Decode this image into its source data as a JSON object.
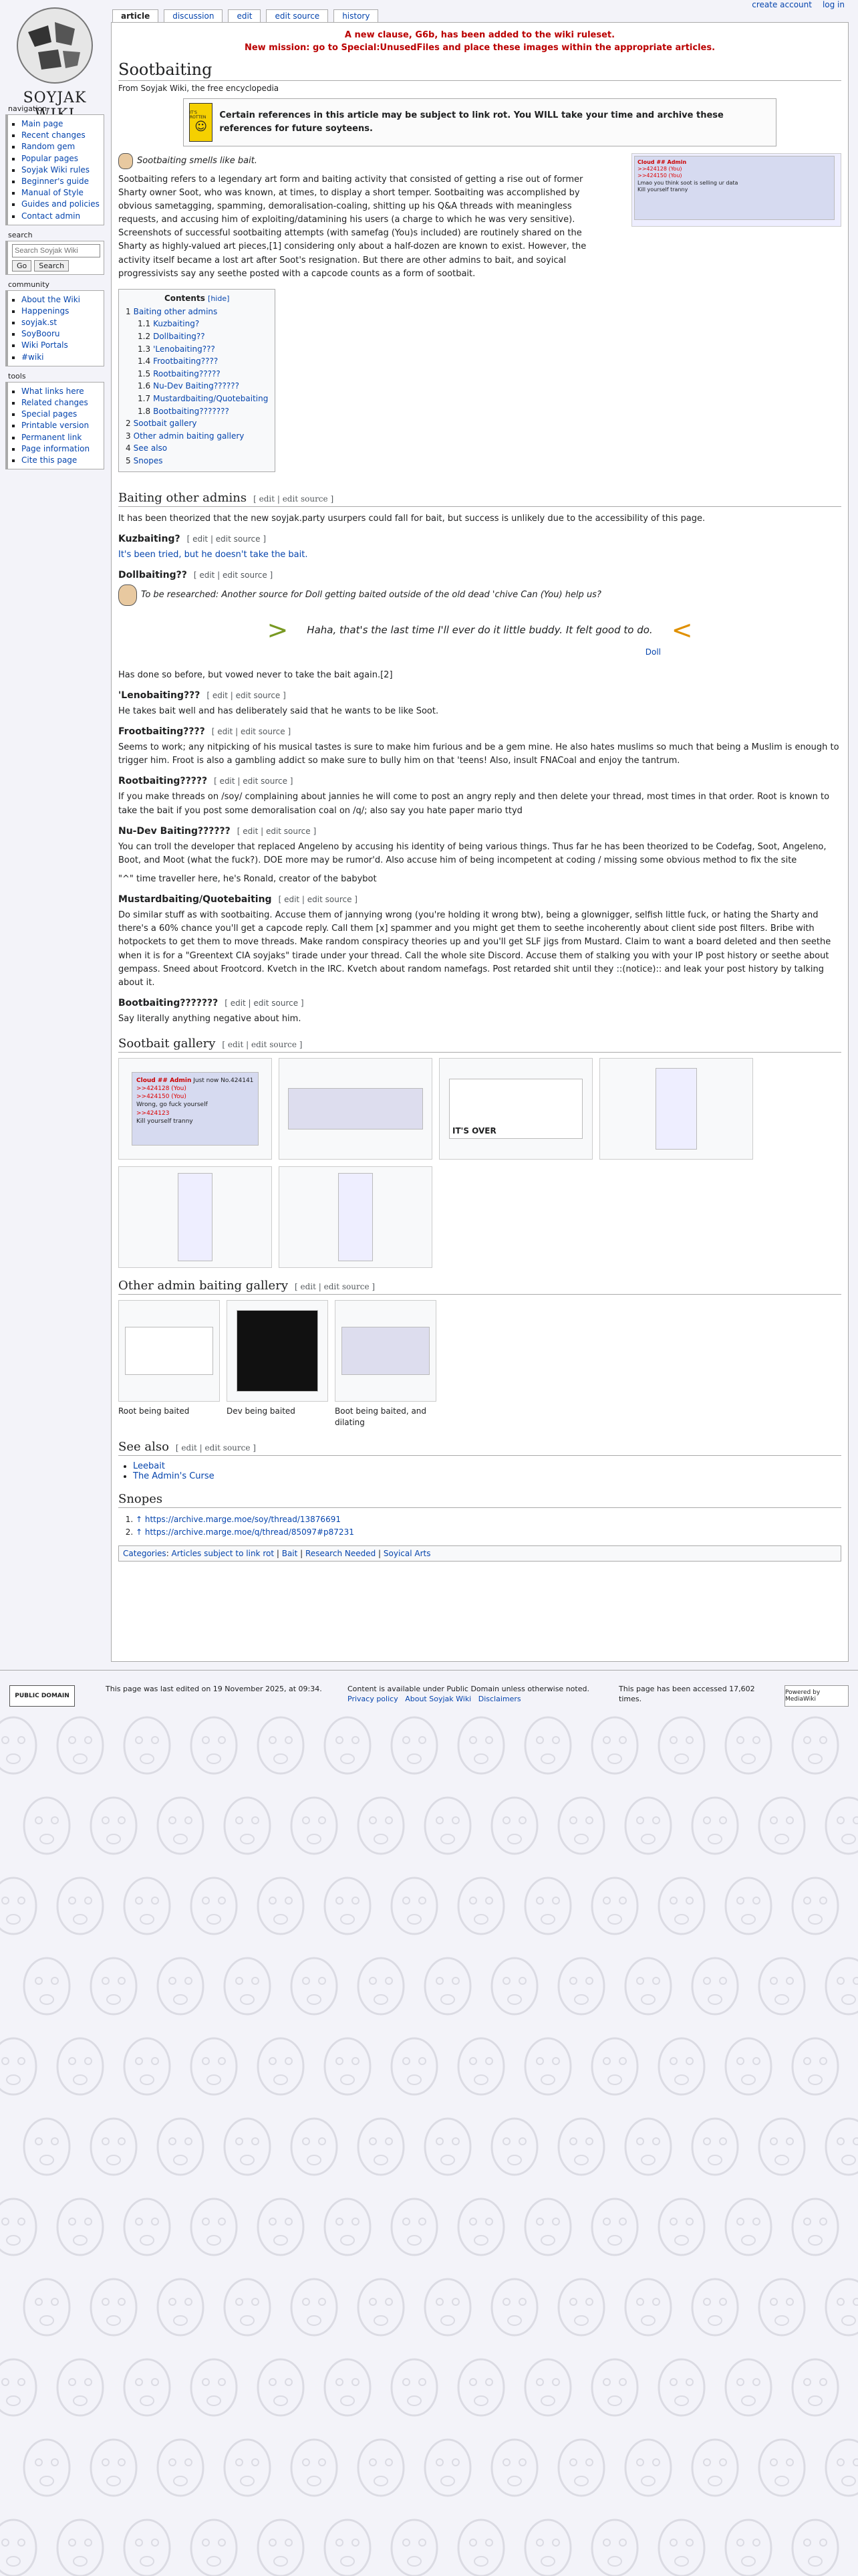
{
  "personal": {
    "create_account": "create account",
    "log_in": "log in"
  },
  "logo": {
    "text": "SOYJAK WIKI"
  },
  "nav": {
    "navigation_title": "navigation",
    "navigation": [
      "Main page",
      "Recent changes",
      "Random gem",
      "Popular pages",
      "Soyjak Wiki rules",
      "Beginner's guide",
      "Manual of Style",
      "Guides and policies",
      "Contact admin"
    ],
    "search_title": "search",
    "search_placeholder": "Search Soyjak Wiki",
    "go": "Go",
    "search_button": "Search",
    "community_title": "community",
    "community": [
      "About the Wiki",
      "Happenings",
      "soyjak.st",
      "SoyBooru",
      "Wiki Portals",
      "#wiki"
    ],
    "tools_title": "tools",
    "tools": [
      "What links here",
      "Related changes",
      "Special pages",
      "Printable version",
      "Permanent link",
      "Page information",
      "Cite this page"
    ]
  },
  "tabs": [
    "article",
    "discussion",
    "edit",
    "edit source",
    "history"
  ],
  "sitenotice": {
    "line1": "A new clause, G6b, has been added to the wiki ruleset.",
    "line2": "New mission: go to Special:UnusedFiles and place these images within the appropriate articles."
  },
  "page": {
    "title": "Sootbaiting",
    "tagline": "From Soyjak Wiki, the free encyclopedia",
    "linkrot_sign": "IT'S ROTTEN",
    "linkrot_text": "Certain references in this article may be subject to link rot. You WILL take your time and archive these references for future soyteens.",
    "smell": "Sootbaiting smells like bait.",
    "lead": "Sootbaiting refers to a legendary art form and baiting activity that consisted of getting a rise out of former Sharty owner Soot, who was known, at times, to display a short temper. Sootbaiting was accomplished by obvious sametagging, spamming, demoralisation-coaling, shitting up his Q&A threads with meaningless requests, and accusing him of exploiting/datamining his users (a charge to which he was very sensitive). Screenshots of successful sootbaiting attempts (with samefag (You)s included) are routinely shared on the Sharty as highly-valued art pieces,[1] considering only about a half-dozen are known to exist. However, the activity itself became a lost art after Soot's resignation. But there are other admins to bait, and soyical progressivists say any seethe posted with a capcode counts as a form of sootbait."
  },
  "hero_post": {
    "header": "Cloud ## Admin",
    "lines": [
      ">>424128 (You)",
      ">>424150 (You)",
      "Lmao you think soot is selling ur data",
      "Kill yourself tranny"
    ]
  },
  "toc": {
    "title": "Contents",
    "hide": "[hide]",
    "items": [
      {
        "n": "1",
        "t": "Baiting other admins",
        "sub": false
      },
      {
        "n": "1.1",
        "t": "Kuzbaiting?",
        "sub": true
      },
      {
        "n": "1.2",
        "t": "Dollbaiting??",
        "sub": true
      },
      {
        "n": "1.3",
        "t": "'Lenobaiting???",
        "sub": true
      },
      {
        "n": "1.4",
        "t": "Frootbaiting????",
        "sub": true
      },
      {
        "n": "1.5",
        "t": "Rootbaiting?????",
        "sub": true
      },
      {
        "n": "1.6",
        "t": "Nu-Dev Baiting??????",
        "sub": true
      },
      {
        "n": "1.7",
        "t": "Mustardbaiting/Quotebaiting",
        "sub": true
      },
      {
        "n": "1.8",
        "t": "Bootbaiting???????",
        "sub": true
      },
      {
        "n": "2",
        "t": "Sootbait gallery",
        "sub": false
      },
      {
        "n": "3",
        "t": "Other admin baiting gallery",
        "sub": false
      },
      {
        "n": "4",
        "t": "See also",
        "sub": false
      },
      {
        "n": "5",
        "t": "Snopes",
        "sub": false
      }
    ]
  },
  "edit_label": "[ edit | edit source ]",
  "sections": {
    "baiting_other_admins": {
      "title": "Baiting other admins",
      "text": "It has been theorized that the new soyjak.party usurpers could fall for bait, but success is unlikely due to the accessibility of this page."
    },
    "kuzbaiting": {
      "title": "Kuzbaiting?",
      "text": "It's been tried, but he doesn't take the bait."
    },
    "dollbaiting": {
      "title": "Dollbaiting??",
      "note": "To be researched: Another source for Doll getting baited outside of the old dead 'chive Can (You) help us?",
      "quote": "Haha, that's the last time I'll ever do it little buddy. It felt good to do.",
      "quote_attr": "Doll",
      "after": "Has done so before, but vowed never to take the bait again.[2]"
    },
    "lenobaiting": {
      "title": "'Lenobaiting???",
      "text": "He takes bait well and has deliberately said that he wants to be like Soot."
    },
    "frootbaiting": {
      "title": "Frootbaiting????",
      "text": "Seems to work; any nitpicking of his musical tastes is sure to make him furious and be a gem mine. He also hates muslims so much that being a Muslim is enough to trigger him. Froot is also a gambling addict so make sure to bully him on that 'teens! Also, insult FNACoal and enjoy the tantrum."
    },
    "rootbaiting": {
      "title": "Rootbaiting?????",
      "text": "If you make threads on /soy/ complaining about jannies he will come to post an angry reply and then delete your thread, most times in that order. Root is known to take the bait if you post some demoralisation coal on /q/; also say you hate paper mario ttyd"
    },
    "nudev": {
      "title": "Nu-Dev Baiting??????",
      "text": "You can troll the developer that replaced Angeleno by accusing his identity of being various things. Thus far he has been theorized to be Codefag, Soot, Angeleno, Boot, and Moot (what the fuck?). DOE more may be rumor'd. Also accuse him of being incompetent at coding / missing some obvious method to fix the site",
      "text2": "\"^\" time traveller here, he's Ronald, creator of the babybot"
    },
    "mustard": {
      "title": "Mustardbaiting/Quotebaiting",
      "text": "Do similar stuff as with sootbaiting. Accuse them of jannying wrong (you're holding it wrong btw), being a glownigger, selfish little fuck, or hating the Sharty and there's a 60% chance you'll get a capcode reply. Call them [x] spammer and you might get them to seethe incoherently about client side post filters. Bribe with hotpockets to get them to move threads. Make random conspiracy theories up and you'll get SLF jigs from Mustard. Claim to want a board deleted and then seethe when it is for a \"Greentext CIA soyjaks\" tirade under your thread. Call the whole site Discord. Accuse them of stalking you with your IP post history or seethe about gempass. Sneed about Frootcord. Kvetch in the IRC. Kvetch about random namefags. Post retarded shit until they ::(notice):: and leak your post history by talking about it."
    },
    "bootbaiting": {
      "title": "Bootbaiting???????",
      "text": "Say literally anything negative about him."
    },
    "sootbait_gallery": {
      "title": "Sootbait gallery"
    },
    "other_gallery": {
      "title": "Other admin baiting gallery",
      "captions": [
        "Root being baited",
        "Dev being baited",
        "Boot being baited, and dilating"
      ]
    },
    "see_also": {
      "title": "See also",
      "items": [
        "Leebait",
        "The Admin's Curse"
      ]
    },
    "snopes": {
      "title": "Snopes",
      "refs": [
        "↑ https://archive.marge.moe/soy/thread/13876691",
        "↑ https://archive.marge.moe/q/thread/85097#p87231"
      ]
    }
  },
  "gallery_post": {
    "header": "Cloud ## Admin",
    "meta": "Just now No.424141",
    "lines": [
      ">>424128 (You)",
      ">>424150 (You)",
      "Wrong, go fuck yourself",
      ">>424123",
      "Kill yourself tranny"
    ],
    "itsover": "IT'S OVER"
  },
  "categories": {
    "label": "Categories",
    "items": [
      "Articles subject to link rot",
      "Bait",
      "Research Needed",
      "Soyical Arts"
    ]
  },
  "footer": {
    "pd_badge": "PUBLIC DOMAIN",
    "edited": "This page was last edited on 19 November 2025, at 09:34.",
    "license": "Content is available under Public Domain unless otherwise noted.",
    "privacy": "Privacy policy",
    "about": "About Soyjak Wiki",
    "disclaimers": "Disclaimers",
    "accessed": "This page has been accessed 17,602 times.",
    "mw_badge": "Powered by MediaWiki"
  }
}
